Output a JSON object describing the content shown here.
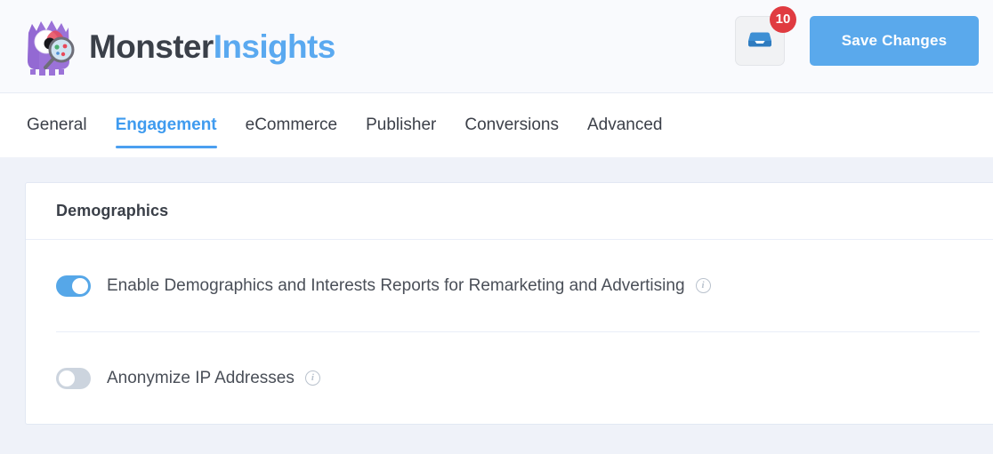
{
  "header": {
    "brand": {
      "name_part1": "Monster",
      "name_part2": "Insights",
      "logo_icon": "monster-magnifier-logo"
    },
    "inbox": {
      "icon": "inbox-tray-icon",
      "badge_count": "10"
    },
    "save_label": "Save Changes",
    "accent_color": "#5aa9ec",
    "badge_color": "#e03b41"
  },
  "tabs": [
    {
      "label": "General",
      "active": false
    },
    {
      "label": "Engagement",
      "active": true
    },
    {
      "label": "eCommerce",
      "active": false
    },
    {
      "label": "Publisher",
      "active": false
    },
    {
      "label": "Conversions",
      "active": false
    },
    {
      "label": "Advanced",
      "active": false
    }
  ],
  "card": {
    "title": "Demographics",
    "settings": [
      {
        "label": "Enable Demographics and Interests Reports for Remarketing and Advertising",
        "toggle_state": "on",
        "info_icon": "info-circle-icon",
        "info_glyph": "i"
      },
      {
        "label": "Anonymize IP Addresses",
        "toggle_state": "off",
        "info_icon": "info-circle-icon",
        "info_glyph": "i"
      }
    ]
  }
}
